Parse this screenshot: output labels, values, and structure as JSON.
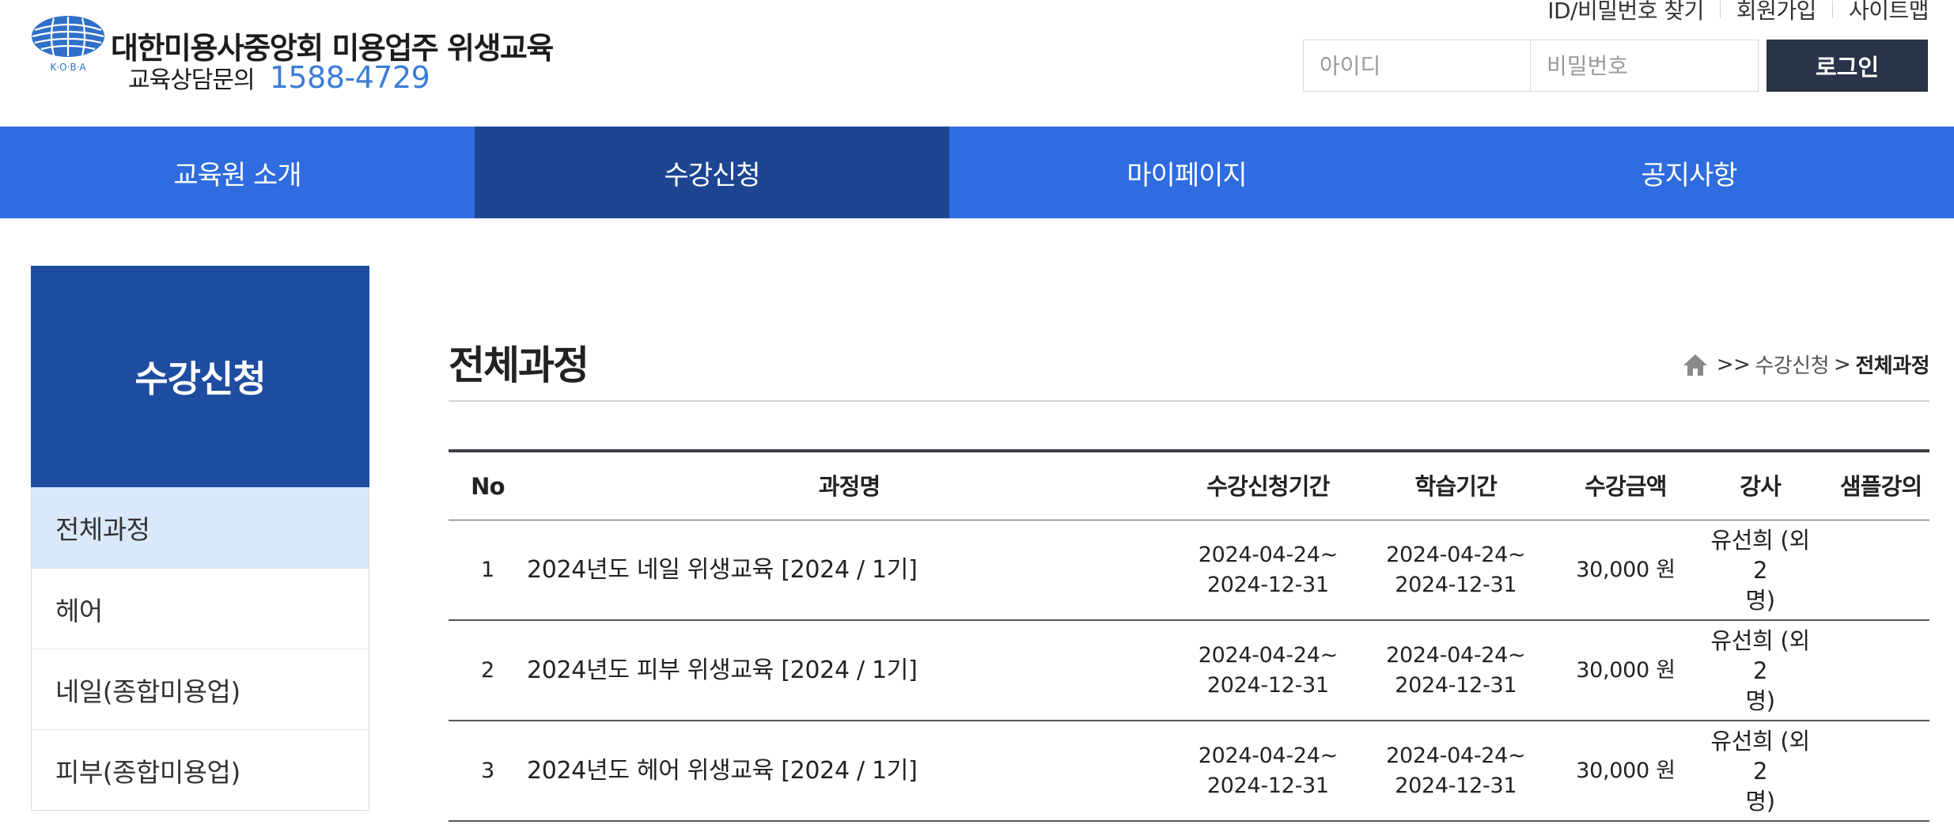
{
  "header": {
    "logo_title": "대한미용사중앙회 미용업주 위생교육",
    "logo_emblem_text": "K·O·B·A",
    "consult_label": "교육상담문의",
    "consult_phone": "1588-4729",
    "util_links": [
      "ID/비밀번호 찾기",
      "회원가입",
      "사이트맵"
    ],
    "login": {
      "id_placeholder": "아이디",
      "pw_placeholder": "비밀번호",
      "button_label": "로그인"
    }
  },
  "gnb": {
    "items": [
      "교육원 소개",
      "수강신청",
      "마이페이지",
      "공지사항"
    ],
    "active_index": 1
  },
  "sidebar": {
    "title": "수강신청",
    "items": [
      "전체과정",
      "헤어",
      "네일(종합미용업)",
      "피부(종합미용업)"
    ],
    "active_index": 0
  },
  "content": {
    "title": "전체과정",
    "breadcrumb": {
      "home_icon": "home-icon",
      "sep1": ">>",
      "item1": "수강신청",
      "sep2": ">",
      "current": "전체과정"
    },
    "table": {
      "headers": [
        "No",
        "과정명",
        "수강신청기간",
        "학습기간",
        "수강금액",
        "강사",
        "샘플강의"
      ],
      "rows": [
        {
          "no": "1",
          "name": "2024년도 네일 위생교육 [2024 / 1기]",
          "apply_start": "2024-04-24~",
          "apply_end": "2024-12-31",
          "study_start": "2024-04-24~",
          "study_end": "2024-12-31",
          "price": "30,000 원",
          "teacher_line1": "유선희 (외 2",
          "teacher_line2": "명)",
          "sample": ""
        },
        {
          "no": "2",
          "name": "2024년도 피부 위생교육 [2024 / 1기]",
          "apply_start": "2024-04-24~",
          "apply_end": "2024-12-31",
          "study_start": "2024-04-24~",
          "study_end": "2024-12-31",
          "price": "30,000 원",
          "teacher_line1": "유선희 (외 2",
          "teacher_line2": "명)",
          "sample": ""
        },
        {
          "no": "3",
          "name": "2024년도 헤어 위생교육 [2024 / 1기]",
          "apply_start": "2024-04-24~",
          "apply_end": "2024-12-31",
          "study_start": "2024-04-24~",
          "study_end": "2024-12-31",
          "price": "30,000 원",
          "teacher_line1": "유선희 (외 2",
          "teacher_line2": "명)",
          "sample": ""
        }
      ]
    }
  },
  "colors": {
    "gnb_bg": "#2e6cdf",
    "gnb_active": "#1d4592",
    "sidebar_title_bg": "#1e4da0",
    "sidebar_active_bg": "#dae8fb",
    "login_button_bg": "#2a3348",
    "phone_color": "#3b7dd8"
  }
}
